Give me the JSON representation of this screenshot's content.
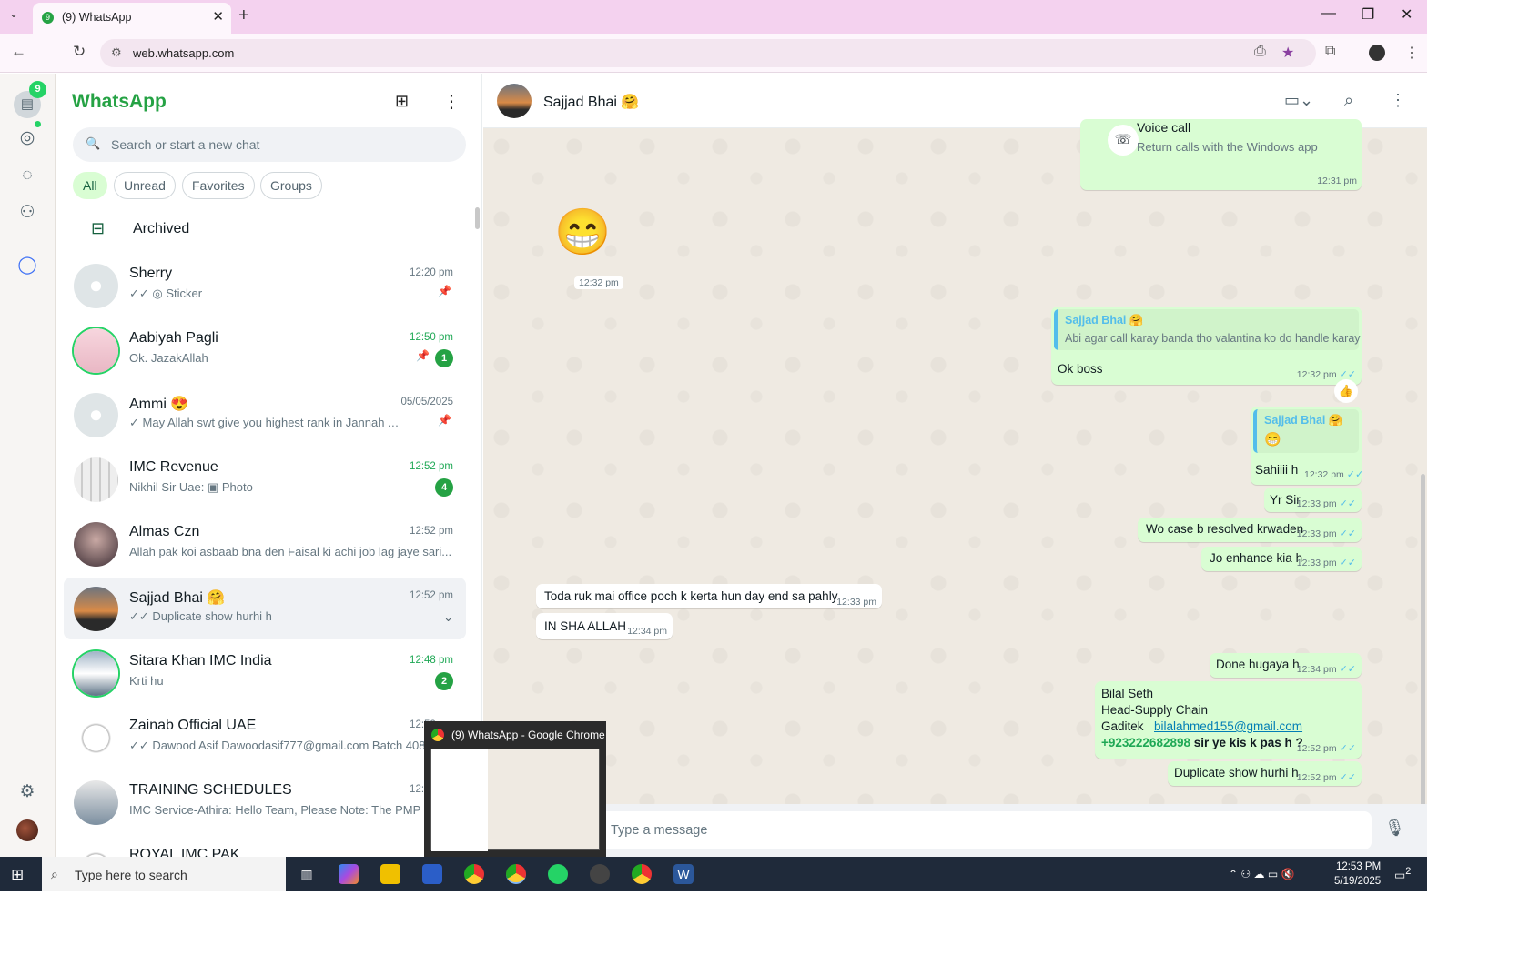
{
  "browser": {
    "tab_title": "(9) WhatsApp",
    "tab_favicon_text": "9",
    "url": "web.whatsapp.com",
    "new_tab": "+",
    "close": "✕",
    "minimize": "—",
    "restore": "❐",
    "window_close": "✕"
  },
  "rail": {
    "chats_badge": "9"
  },
  "sidebar": {
    "brand": "WhatsApp",
    "search_placeholder": "Search or start a new chat",
    "filters": [
      "All",
      "Unread",
      "Favorites",
      "Groups"
    ],
    "archived_label": "Archived",
    "chats": [
      {
        "name": "Sherry",
        "preview": "✓✓ ◎ Sticker",
        "time": "12:20 pm",
        "pinned": true,
        "unread": "",
        "avatar": "default"
      },
      {
        "name": "Aabiyah Pagli",
        "preview": "Ok. JazakAllah",
        "time": "12:50 pm",
        "pinned": true,
        "unread": "1",
        "avatar": "photo-pink"
      },
      {
        "name": "Ammi 😍",
        "preview": "✓ May Allah swt give you highest rank in Jannah  Ameen",
        "time": "05/05/2025",
        "pinned": true,
        "unread": "",
        "avatar": "default"
      },
      {
        "name": "IMC Revenue",
        "preview": "Nikhil Sir Uae: ▣ Photo",
        "time": "12:52 pm",
        "pinned": false,
        "unread": "4",
        "avatar": "photo-grid"
      },
      {
        "name": "Almas Czn",
        "preview": "Allah pak koi asbaab bna den Faisal ki achi job lag jaye sari...",
        "time": "12:52 pm",
        "pinned": false,
        "unread": "",
        "avatar": "photo-dark"
      },
      {
        "name": "Sajjad Bhai 🤗",
        "preview": "✓✓ Duplicate show hurhi h",
        "time": "12:52 pm",
        "pinned": false,
        "unread": "",
        "avatar": "photo-sunset"
      },
      {
        "name": "Sitara Khan IMC India",
        "preview": "Krti hu",
        "time": "12:48 pm",
        "pinned": false,
        "unread": "2",
        "avatar": "photo-sky"
      },
      {
        "name": "Zainab Official UAE",
        "preview": "✓✓ Dawood Asif  Dawoodasif777@gmail.com Batch 408...",
        "time": "12:52 pm",
        "pinned": false,
        "unread": "",
        "avatar": "photo-logo"
      },
      {
        "name": "TRAINING SCHEDULES",
        "preview": "IMC Service-Athira: Hello Team, Please Note: The PMP Batch...",
        "time": "12:52 pm",
        "pinned": false,
        "unread": "",
        "avatar": "photo-gray"
      },
      {
        "name": "ROYAL IMC PAK",
        "preview": "",
        "time": "",
        "pinned": false,
        "unread": "",
        "avatar": "photo-logo"
      }
    ]
  },
  "chat": {
    "contact_name": "Sajjad Bhai 🤗",
    "voice_call_title": "Voice call",
    "voice_call_sub": "Return calls with the Windows app",
    "voice_call_time": "12:31 pm",
    "emoji_msg": "😁",
    "emoji_time": "12:32 pm",
    "messages": {
      "reply1_quote_name": "Sajjad Bhai 🤗",
      "reply1_quote_text": "Abi agar call karay banda tho valantina ko do handle karay",
      "reply1_text": "Ok boss",
      "reply1_time": "12:32 pm",
      "reply1_reaction": "👍",
      "reply2_quote_name": "Sajjad Bhai 🤗",
      "reply2_quote_text": "😁",
      "reply2_text": "Sahiiii h",
      "reply2_time": "12:32 pm",
      "m_yrsir": "Yr Sir",
      "m_yrsir_time": "12:33 pm",
      "m_case": "Wo case b resolved krwaden",
      "m_case_time": "12:33 pm",
      "m_enhance": "Jo enhance kia h",
      "m_enhance_time": "12:33 pm",
      "in_toda": "Toda ruk mai office poch k kerta hun day end sa pahly",
      "in_toda_time": "12:33 pm",
      "in_insha": "IN SHA ALLAH",
      "in_insha_time": "12:34 pm",
      "m_done": "Done hugaya h",
      "m_done_time": "12:34 pm",
      "m_bilal_1": "Bilal Seth",
      "m_bilal_2": "Head-Supply Chain",
      "m_bilal_3a": "Gaditek",
      "m_bilal_email": "bilalahmed155@gmail.com",
      "m_bilal_phone": "+923222682898",
      "m_bilal_tail": " sir ye kis k pas h ?",
      "m_bilal_time": "12:52 pm",
      "m_dup": "Duplicate show hurhi h",
      "m_dup_time": "12:52 pm",
      "tick": "✓✓"
    },
    "input_placeholder": "Type a message"
  },
  "preview": {
    "title": "(9) WhatsApp - Google Chrome"
  },
  "taskbar": {
    "search_placeholder": "Type here to search",
    "time": "12:53 PM",
    "date": "5/19/2025",
    "notif_count": "2"
  }
}
